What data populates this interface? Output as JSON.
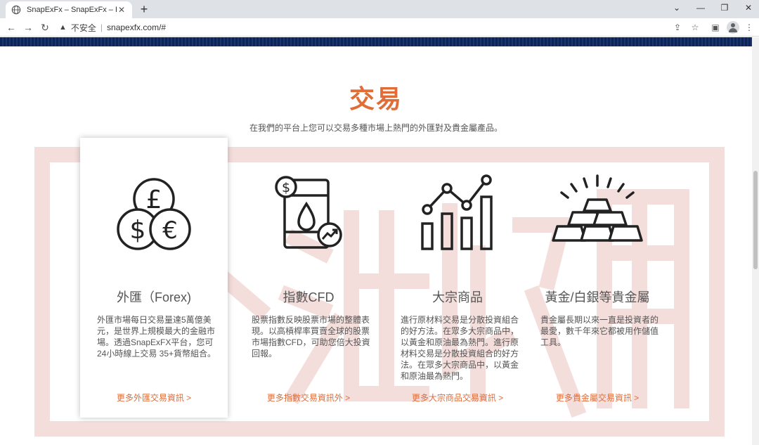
{
  "browser": {
    "tab_title": "SnapExFx – SnapExFx – Forex",
    "tab_close": "✕",
    "new_tab": "+",
    "insecure_label": "不安全",
    "url": "snapexfx.com/#"
  },
  "section": {
    "title": "交易",
    "subtitle": "在我們的平台上您可以交易多種市場上熱門的外匯對及貴金屬產品。"
  },
  "cards": [
    {
      "title": "外匯（Forex)",
      "description": "外匯市場每日交易量達5萬億美元，是世界上規模最大的金融市場。透過SnapExFX平台，您可24小時線上交易 35+貨幣組合。",
      "link": "更多外匯交易資訊 >",
      "icon": "currency-coins-icon"
    },
    {
      "title": "指數CFD",
      "description": "股票指數反映股票市場的整體表現。以高槓桿率買賣全球的股票市場指數CFD，可助您倍大投資回報。",
      "link": "更多指數交易資訊外 >",
      "icon": "oil-barrel-icon"
    },
    {
      "title": "大宗商品",
      "description": "進行原材料交易是分散投資組合的好方法。在眾多大宗商品中，以黃金和原油最為熱門。進行原材料交易是分散投資組合的好方法。在眾多大宗商品中，以黃金和原油最為熱門。",
      "link": "更多大宗商品交易資訊 >",
      "icon": "bar-line-chart-icon"
    },
    {
      "title": "黃金/白銀等貴金屬",
      "description": "貴金屬長期以來一直是投資者的最愛，數千年來它都被用作儲值工具。",
      "link": "更多貴金屬交易資訊 >",
      "icon": "gold-bars-icon"
    }
  ],
  "colors": {
    "accent": "#e06c37",
    "navy": "#0d2457",
    "watermark": "#c0392b"
  }
}
